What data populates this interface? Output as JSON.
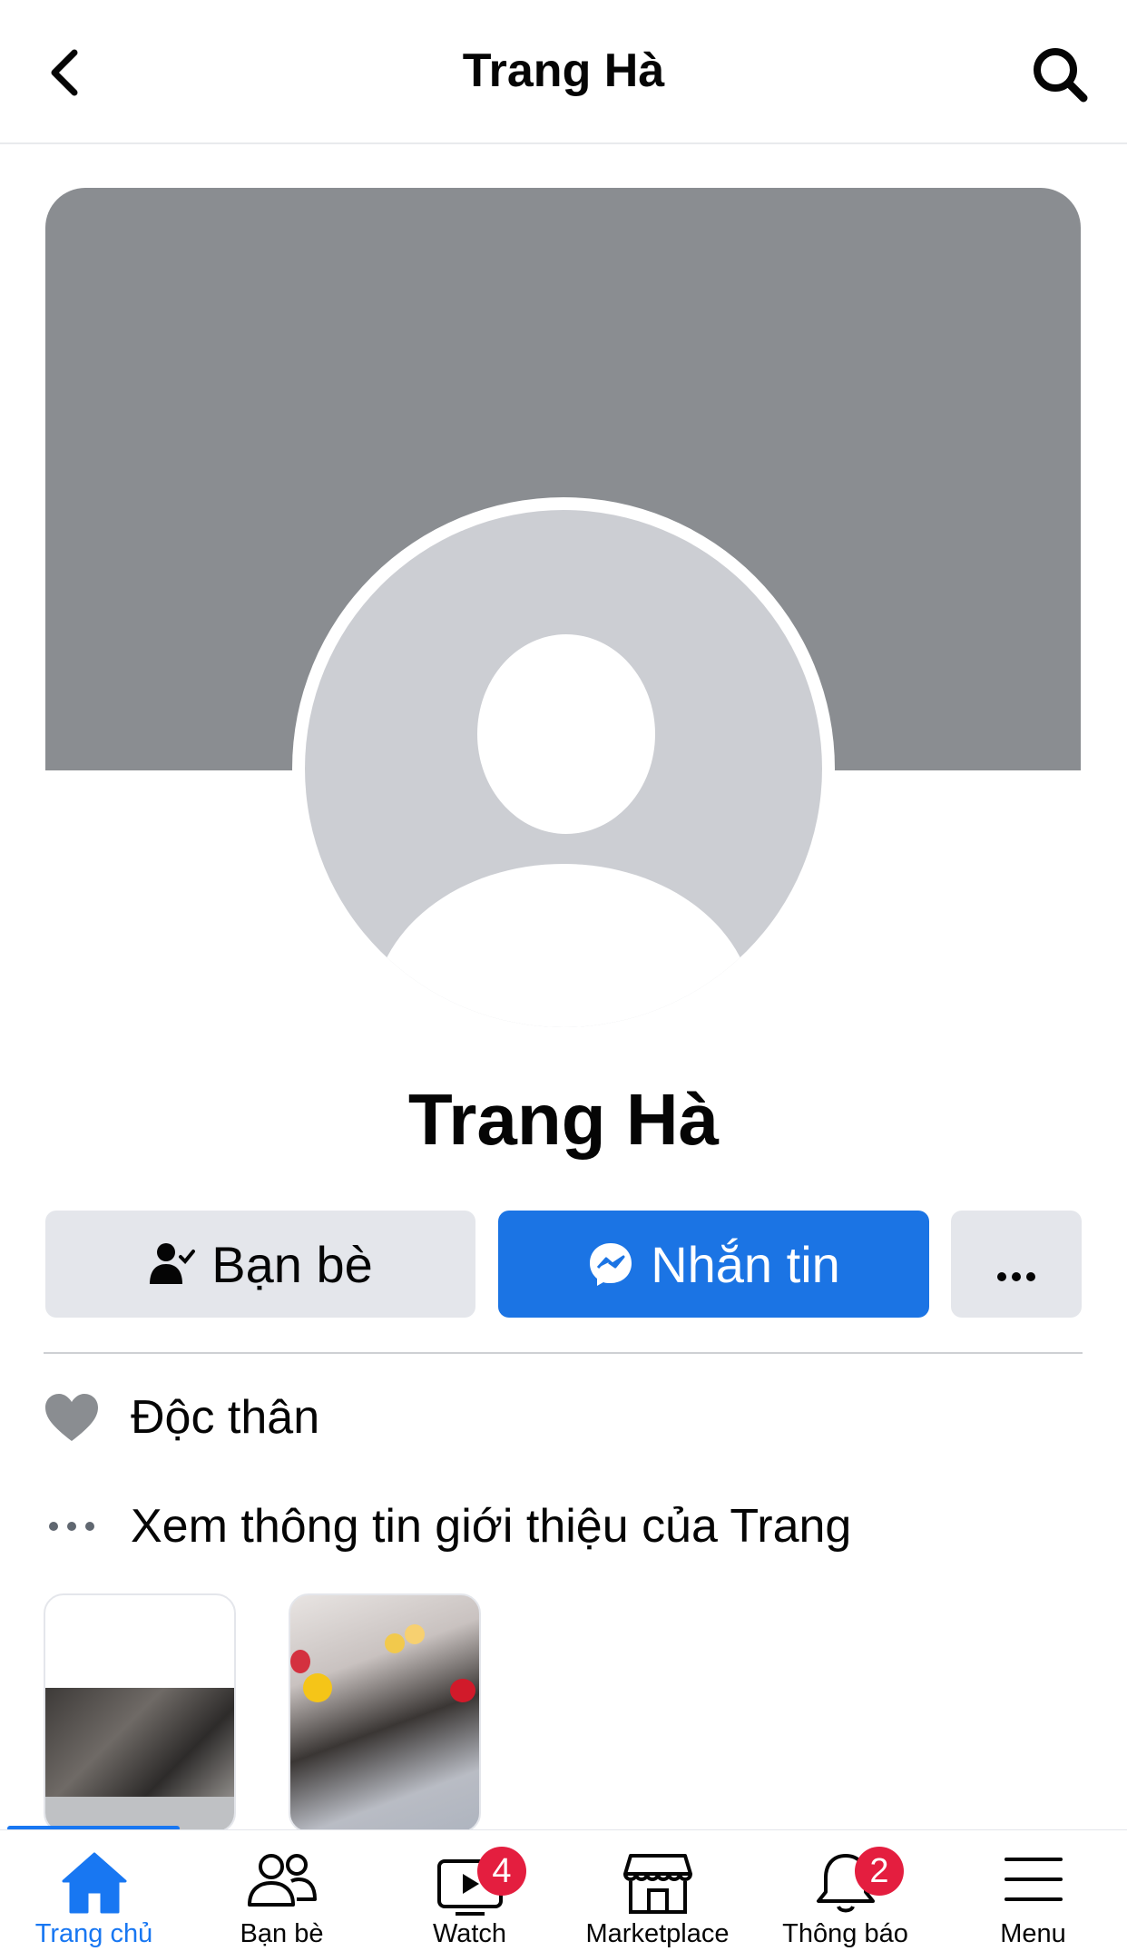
{
  "header": {
    "title": "Trang Hà"
  },
  "profile": {
    "name": "Trang Hà"
  },
  "actions": {
    "friends_label": "Bạn bè",
    "message_label": "Nhắn tin"
  },
  "info": {
    "relationship": "Độc thân",
    "see_about": "Xem thông tin giới thiệu của Trang"
  },
  "colors": {
    "accent": "#1877f2",
    "button_blue": "#1b74e4",
    "badge": "#e41e3f",
    "cover": "#8a8d91"
  },
  "tabs": [
    {
      "label": "Trang chủ",
      "icon": "home-icon",
      "active": true
    },
    {
      "label": "Bạn bè",
      "icon": "friends-icon"
    },
    {
      "label": "Watch",
      "icon": "watch-icon",
      "badge": "4"
    },
    {
      "label": "Marketplace",
      "icon": "marketplace-icon"
    },
    {
      "label": "Thông báo",
      "icon": "bell-icon",
      "badge": "2"
    },
    {
      "label": "Menu",
      "icon": "menu-icon"
    }
  ]
}
